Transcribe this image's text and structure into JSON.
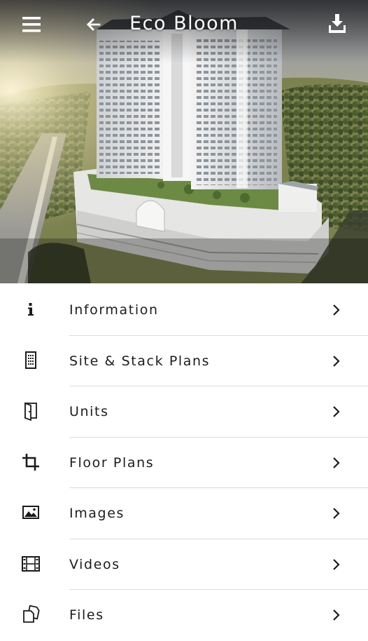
{
  "header": {
    "title": "Eco Bloom",
    "menu_icon": "hamburger-menu-icon",
    "back_icon": "arrow-left-icon",
    "download_icon": "download-icon"
  },
  "hero": {
    "description": "rendering of residential tower"
  },
  "menu": {
    "items": [
      {
        "label": "Information",
        "icon": "info-icon"
      },
      {
        "label": "Site & Stack Plans",
        "icon": "building-icon"
      },
      {
        "label": "Units",
        "icon": "door-icon"
      },
      {
        "label": "Floor Plans",
        "icon": "crop-icon"
      },
      {
        "label": "Images",
        "icon": "image-icon"
      },
      {
        "label": "Videos",
        "icon": "film-icon"
      },
      {
        "label": "Files",
        "icon": "files-icon"
      }
    ]
  },
  "colors": {
    "text": "#1d1d1d",
    "divider": "#dcdcdc",
    "header_text": "#ffffff"
  }
}
